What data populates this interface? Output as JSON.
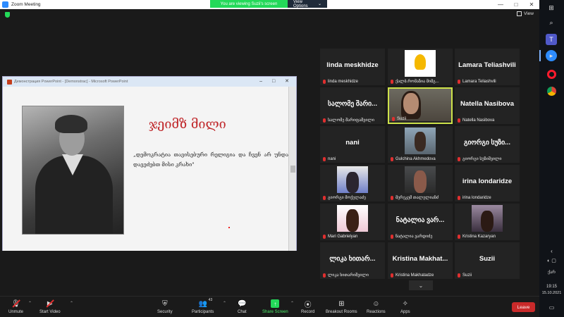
{
  "window": {
    "title": "Zoom Meeting",
    "controls": [
      "—",
      "□",
      "✕"
    ]
  },
  "banner": {
    "viewing": "You are viewing Suzii's screen",
    "options": "View Options"
  },
  "view_label": "View",
  "shared_window": {
    "title": "Демонстрация PowerPoint - [Demonstrac] - Microsoft PowerPoint",
    "slide_title": "ჯეიმზ მილი",
    "slide_quote": "„დემოკრატია თავისებური რელიგია და ჩვენ არ უნდა დავეძებთ მისი კრახი\""
  },
  "participants": [
    {
      "big": "linda meskhidze",
      "label": "linda meskhidze",
      "video": ""
    },
    {
      "big": "",
      "label": "ქალბ.რომაზია მიმგ...",
      "video": "vp-logo"
    },
    {
      "big": "Lamara Teliashvili",
      "label": "Lamara Teliashvili",
      "video": ""
    },
    {
      "big": "სალომე შარი...",
      "label": "სალომე შარიფაშვილი",
      "video": ""
    },
    {
      "big": "",
      "label": "Suzii",
      "video": "cam"
    },
    {
      "big": "Natella Nasibova",
      "label": "Natella Nasibova",
      "video": ""
    },
    {
      "big": "nani",
      "label": "nani",
      "video": ""
    },
    {
      "big": "",
      "label": "Gulchina Akhmedova",
      "video": "vp-a"
    },
    {
      "big": "გიორგი სუზი...",
      "label": "გიორგი სუზიშვილი",
      "video": ""
    },
    {
      "big": "",
      "label": "გიორგი მოქელაძე",
      "video": "vp-b"
    },
    {
      "big": "",
      "label": "მერეკემ თალელიანძ",
      "video": "vp-c"
    },
    {
      "big": "irina londaridze",
      "label": "irina londaridze",
      "video": ""
    },
    {
      "big": "",
      "label": "Mari Gabrielyan",
      "video": "vp-d"
    },
    {
      "big": "ნატალია ვარ...",
      "label": "ნატალია ვარდიძე",
      "video": ""
    },
    {
      "big": "",
      "label": "Kristina Kazaryan",
      "video": "vp-e"
    },
    {
      "big": "ლიკა ხითარ...",
      "label": "ლიკა ხითარიშვილი",
      "video": ""
    },
    {
      "big": "Kristina Makhat...",
      "label": "Kristina Makhatadze",
      "video": ""
    },
    {
      "big": "Suzii",
      "label": "Suzii",
      "video": ""
    }
  ],
  "toolbar": {
    "unmute": "Unmute",
    "start_video": "Start Video",
    "security": "Security",
    "participants": "Participants",
    "participants_count": "43",
    "chat": "Chat",
    "share_screen": "Share Screen",
    "record": "Record",
    "breakout_rooms": "Breakout Rooms",
    "reactions": "Reactions",
    "apps": "Apps",
    "leave": "Leave"
  },
  "tray": {
    "lang": "ქარ",
    "time": "19:15",
    "date": "15.10.2021"
  }
}
